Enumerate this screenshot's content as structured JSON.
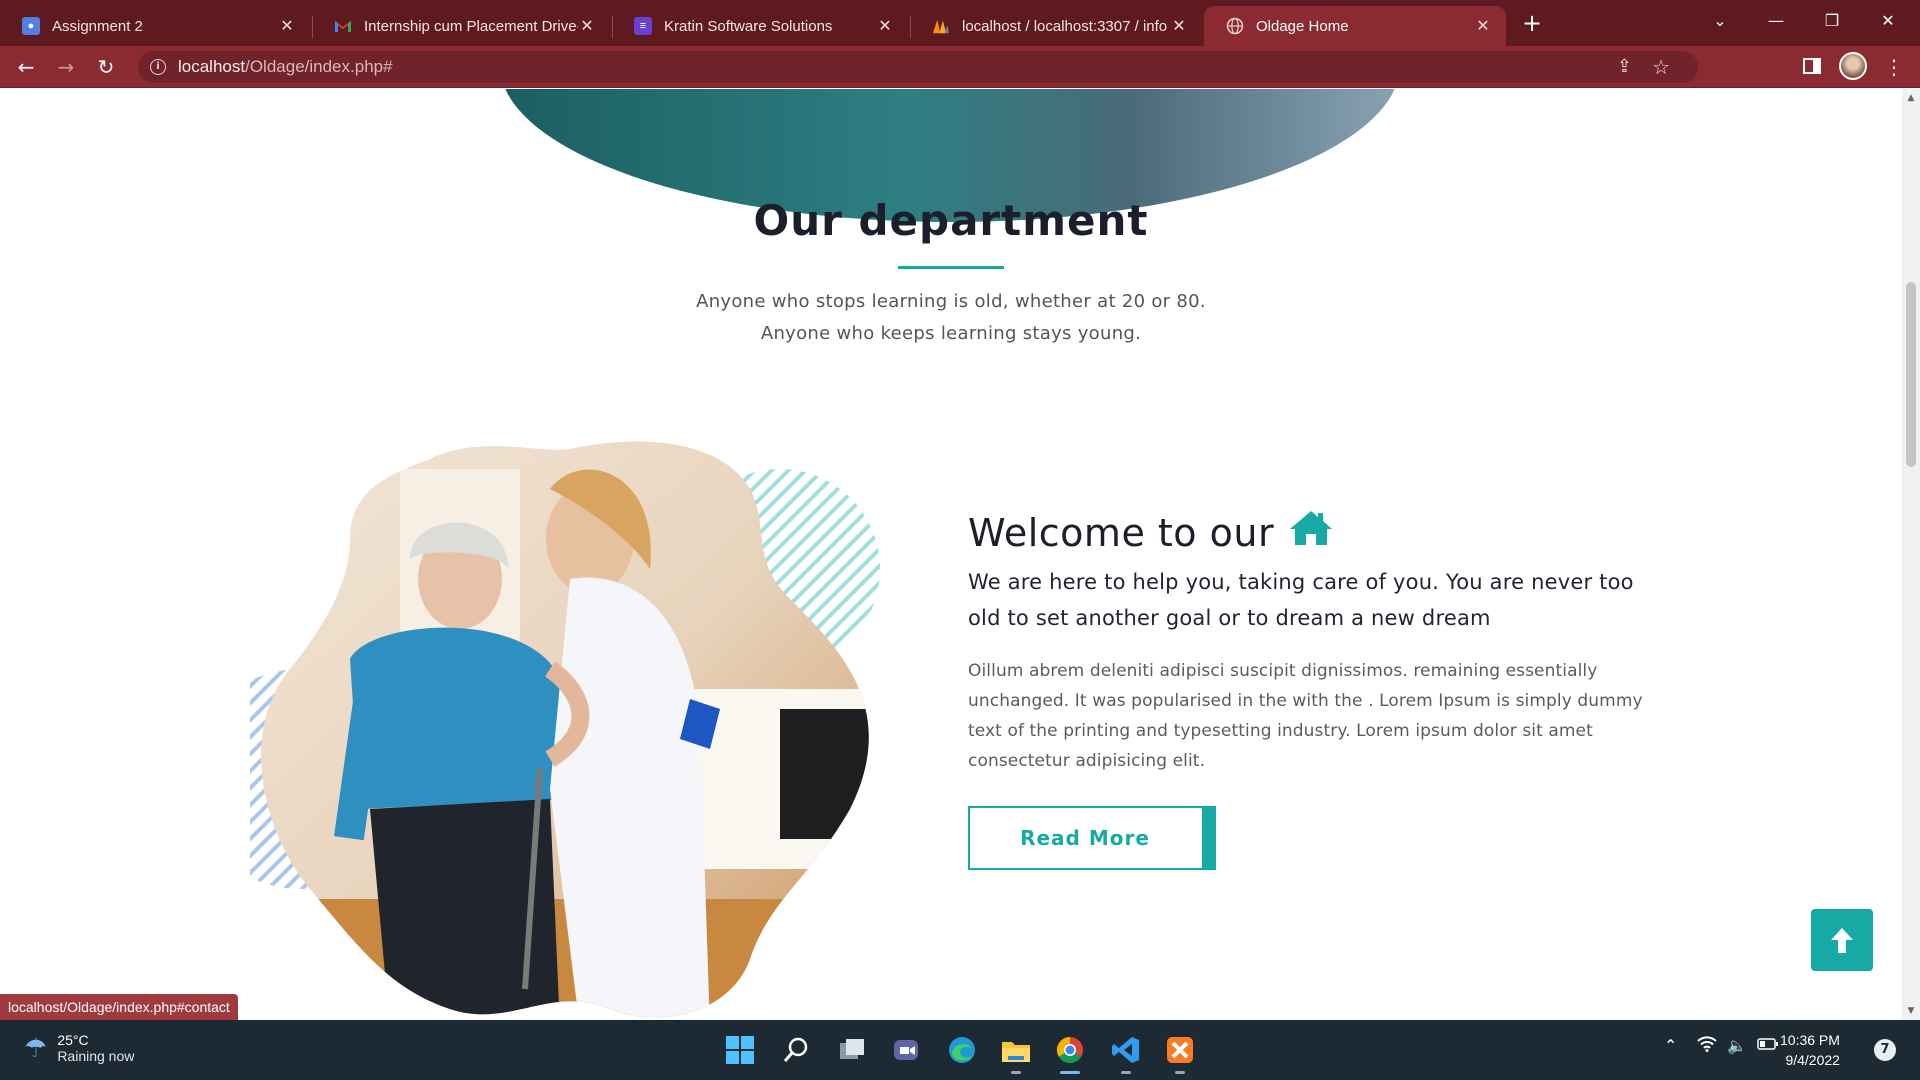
{
  "browser": {
    "tabs": [
      {
        "title": "Assignment 2",
        "icon": "classroom-icon",
        "color": "#4f7fe0"
      },
      {
        "title": "Internship cum Placement Drive-",
        "icon": "gmail-icon",
        "color": "#ea4335"
      },
      {
        "title": "Kratin Software Solutions",
        "icon": "forms-icon",
        "color": "#6a3fd4"
      },
      {
        "title": "localhost / localhost:3307 / info /",
        "icon": "phpmyadmin-icon",
        "color": "#f29111"
      },
      {
        "title": "Oldage Home",
        "icon": "globe-icon",
        "color": "#cccccc",
        "active": true
      }
    ],
    "url_host": "localhost",
    "url_path": "/Oldage/index.php#"
  },
  "page": {
    "section_title": "Our department",
    "subtitle_line1": "Anyone who stops learning is old, whether at 20 or 80.",
    "subtitle_line2": "Anyone who keeps learning stays young.",
    "welcome_heading": "Welcome to our",
    "lead_text": "We are here to help you, taking care of you. You are never too old to set another goal or to dream a new dream",
    "body_text": "Oillum abrem deleniti adipisci suscipit dignissimos. remaining essentially unchanged. It was popularised in the with the . Lorem Ipsum is simply dummy text of the printing and typesetting industry. Lorem ipsum dolor sit amet consectetur adipisicing elit.",
    "read_more_label": "Read More",
    "status_url": "localhost/Oldage/index.php#contact",
    "accent_color": "#17aaa5"
  },
  "taskbar": {
    "weather_temp": "25°C",
    "weather_desc": "Raining now",
    "time": "10:36 PM",
    "date": "9/4/2022",
    "notification_count": "7"
  }
}
